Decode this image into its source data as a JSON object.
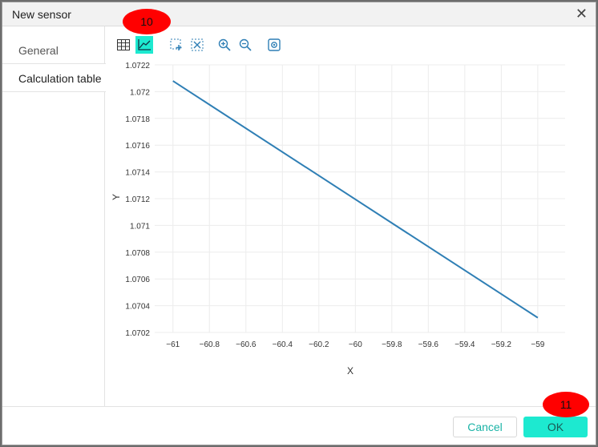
{
  "dialog": {
    "title": "New sensor"
  },
  "sidebar": {
    "items": [
      {
        "label": "General"
      },
      {
        "label": "Calculation table"
      }
    ]
  },
  "toolbar": {
    "buttons": [
      {
        "icon": "table-icon"
      },
      {
        "icon": "line-chart-icon"
      },
      {
        "icon": "zoom-select-icon"
      },
      {
        "icon": "zoom-reset-icon"
      },
      {
        "icon": "zoom-in-icon"
      },
      {
        "icon": "zoom-out-icon"
      },
      {
        "icon": "screenshot-icon"
      }
    ]
  },
  "chart_data": {
    "type": "line",
    "xlabel": "X",
    "ylabel": "Y",
    "xlim": [
      -61.1,
      -58.85
    ],
    "ylim": [
      1.0702,
      1.0722
    ],
    "x_ticks": [
      "−61",
      "−60.8",
      "−60.6",
      "−60.4",
      "−60.2",
      "−60",
      "−59.8",
      "−59.6",
      "−59.4",
      "−59.2",
      "−59"
    ],
    "y_ticks": [
      "1.0702",
      "1.0704",
      "1.0706",
      "1.0708",
      "1.071",
      "1.0712",
      "1.0714",
      "1.0716",
      "1.0718",
      "1.072",
      "1.0722"
    ],
    "grid": true,
    "color": "#2f7fb5",
    "series": [
      {
        "x": [
          -61,
          -59
        ],
        "y": [
          1.07208,
          1.07031
        ]
      }
    ]
  },
  "footer": {
    "cancel_label": "Cancel",
    "ok_label": "OK"
  },
  "markers": [
    {
      "label": "10"
    },
    {
      "label": "11"
    }
  ]
}
